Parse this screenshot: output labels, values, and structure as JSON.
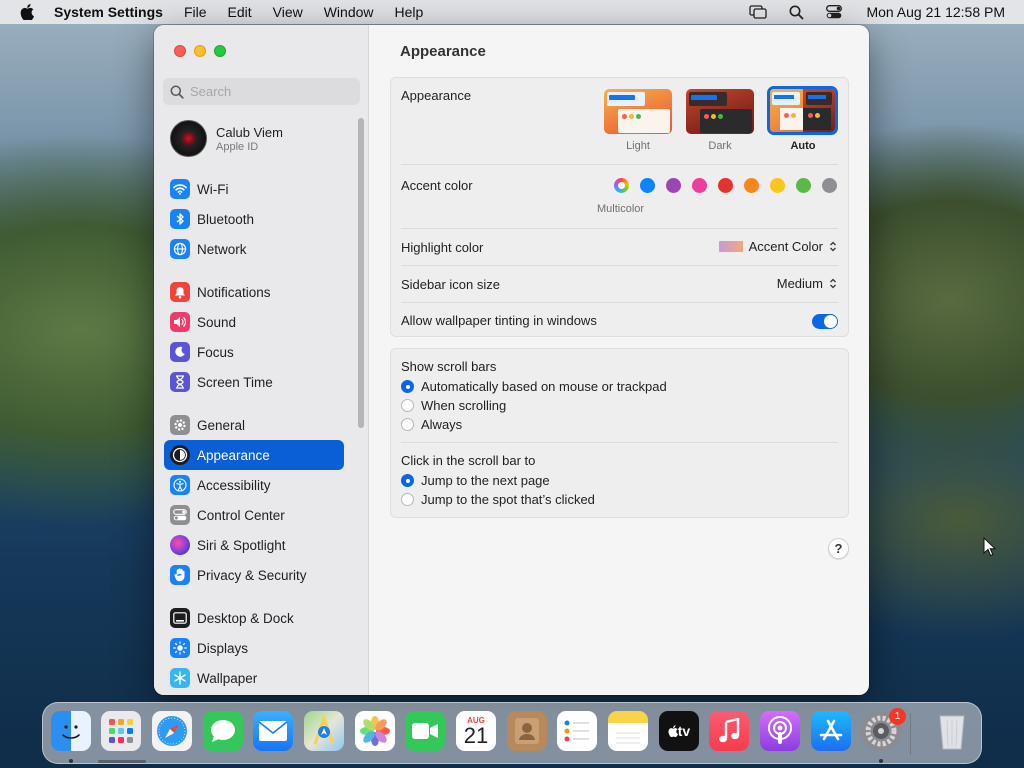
{
  "menubar": {
    "app_name": "System Settings",
    "menus": [
      "File",
      "Edit",
      "View",
      "Window",
      "Help"
    ],
    "clock": "Mon Aug 21  12:58 PM"
  },
  "sidebar": {
    "search_placeholder": "Search",
    "profile": {
      "name": "Calub Viem",
      "subtitle": "Apple ID"
    },
    "groups": [
      [
        {
          "label": "Wi-Fi",
          "icon": "wifi-icon",
          "color": "#1a82f7"
        },
        {
          "label": "Bluetooth",
          "icon": "bluetooth-icon",
          "color": "#1a82f7"
        },
        {
          "label": "Network",
          "icon": "globe-icon",
          "color": "#1a82f7"
        }
      ],
      [
        {
          "label": "Notifications",
          "icon": "bell-icon",
          "color": "#f0443a"
        },
        {
          "label": "Sound",
          "icon": "speaker-icon",
          "color": "#ee3c6a"
        },
        {
          "label": "Focus",
          "icon": "moon-icon",
          "color": "#5b55d6"
        },
        {
          "label": "Screen Time",
          "icon": "hourglass-icon",
          "color": "#5b55d6"
        }
      ],
      [
        {
          "label": "General",
          "icon": "gear-icon",
          "color": "#8e8e93"
        },
        {
          "label": "Appearance",
          "icon": "appearance-icon",
          "color": "#1c1c1e",
          "selected": true
        },
        {
          "label": "Accessibility",
          "icon": "accessibility-icon",
          "color": "#1a82f7"
        },
        {
          "label": "Control Center",
          "icon": "control-center-icon",
          "color": "#8e8e93"
        },
        {
          "label": "Siri & Spotlight",
          "icon": "siri-icon",
          "color": "#7b3fe4"
        },
        {
          "label": "Privacy & Security",
          "icon": "hand-icon",
          "color": "#1a82f7"
        }
      ],
      [
        {
          "label": "Desktop & Dock",
          "icon": "dock-icon",
          "color": "#1c1c1e"
        },
        {
          "label": "Displays",
          "icon": "sun-icon",
          "color": "#1a82f7"
        },
        {
          "label": "Wallpaper",
          "icon": "snowflake-icon",
          "color": "#35b6f0"
        }
      ]
    ]
  },
  "content": {
    "title": "Appearance",
    "appearance": {
      "label": "Appearance",
      "options": [
        "Light",
        "Dark",
        "Auto"
      ],
      "selected": "Auto"
    },
    "accent": {
      "label": "Accent color",
      "selected_name": "Multicolor",
      "colors": [
        "#8e8e93",
        "#0a84ff",
        "#9b46b5",
        "#ee3e9c",
        "#e3332f",
        "#f7861b",
        "#f9c71b",
        "#5cb946",
        "#8e8e93"
      ]
    },
    "highlight": {
      "label": "Highlight color",
      "value": "Accent Color"
    },
    "sidebar_icon_size": {
      "label": "Sidebar icon size",
      "value": "Medium"
    },
    "wallpaper_tinting": {
      "label": "Allow wallpaper tinting in windows",
      "on": true
    },
    "scroll_bars": {
      "label": "Show scroll bars",
      "options": [
        "Automatically based on mouse or trackpad",
        "When scrolling",
        "Always"
      ],
      "selected": 0
    },
    "click_scroll": {
      "label": "Click in the scroll bar to",
      "options": [
        "Jump to the next page",
        "Jump to the spot that’s clicked"
      ],
      "selected": 0
    },
    "help": "?"
  },
  "dock": {
    "apps": [
      "Finder",
      "Launchpad",
      "Safari",
      "Messages",
      "Mail",
      "Maps",
      "Photos",
      "FaceTime",
      "Calendar",
      "Contacts",
      "Reminders",
      "Notes",
      "TV",
      "Music",
      "Podcasts",
      "App Store",
      "System Settings"
    ],
    "calendar_month": "AUG",
    "calendar_day": "21",
    "tv_label": "tv",
    "settings_badge": "1"
  }
}
